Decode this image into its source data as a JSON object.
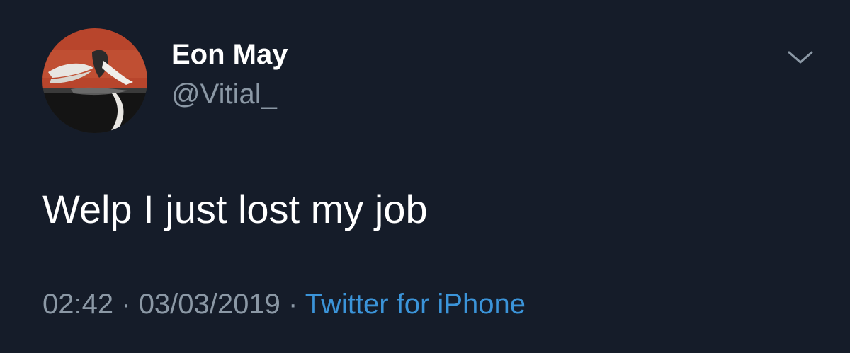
{
  "tweet": {
    "display_name": "Eon May",
    "handle": "@Vitial_",
    "text": "Welp I just lost my job",
    "time": "02:42",
    "separator": "·",
    "date": "03/03/2019",
    "source": "Twitter for iPhone"
  },
  "icons": {
    "menu": "chevron-down-icon"
  },
  "colors": {
    "background": "#151c29",
    "secondary_text": "#8b98a5",
    "link": "#3b94d9"
  }
}
